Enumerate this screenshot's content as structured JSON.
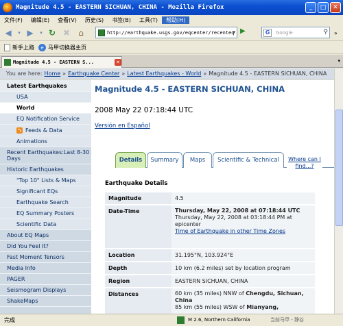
{
  "window": {
    "title": "Magnitude 4.5 - EASTERN SICHUAN, CHINA - Mozilla Firefox",
    "buttons": [
      "_",
      "□",
      "✕"
    ]
  },
  "menubar": {
    "items": [
      "文件(F)",
      "编辑(E)",
      "查看(V)",
      "历史(S)",
      "书签(B)",
      "工具(T)",
      "帮助(H)"
    ]
  },
  "navbar": {
    "url": "http://earthquake.usgs.gov/eqcenter/recenteq",
    "search_placeholder": "Google"
  },
  "bookmarks": {
    "items": [
      "新手上路",
      "马甲切换器主页"
    ]
  },
  "tabbar": {
    "tab_title": "Magnitude 4.5 - EASTERN S..."
  },
  "breadcrumb": {
    "label": "You are here:",
    "items": [
      "Home",
      "Earthquake Center",
      "Latest Earthquakes - World"
    ],
    "current": "Magnitude 4.5 - EASTERN SICHUAN, CHINA"
  },
  "sidebar": {
    "items": [
      {
        "label": "Latest Earthquakes"
      },
      {
        "label": "USA"
      },
      {
        "label": "World"
      },
      {
        "label": "EQ Notification Service"
      },
      {
        "label": "Feeds & Data"
      },
      {
        "label": "Animations"
      },
      {
        "label": "Recent Earthquakes:Last 8-30 Days"
      },
      {
        "label": "Historic Earthquakes"
      },
      {
        "label": "\"Top 10\" Lists & Maps"
      },
      {
        "label": "Significant EQs"
      },
      {
        "label": "Earthquake Search"
      },
      {
        "label": "EQ Summary Posters"
      },
      {
        "label": "Scientific Data"
      },
      {
        "label": "About EQ Maps"
      },
      {
        "label": "Did You Feel It?"
      },
      {
        "label": "Fast Moment Tensors"
      },
      {
        "label": "Media Info"
      },
      {
        "label": "PAGER"
      },
      {
        "label": "Seismogram Displays"
      },
      {
        "label": "ShakeMaps"
      }
    ]
  },
  "main": {
    "title": "Magnitude 4.5 - EASTERN SICHUAN, CHINA",
    "datetime": "2008 May 22 07:18:44 UTC",
    "spanish_link": "Versión en Español",
    "tabs": [
      "Details",
      "Summary",
      "Maps",
      "Scientific & Technical"
    ],
    "where_link": "Where can I find...?",
    "section_title": "Earthquake Details",
    "details": {
      "magnitude_label": "Magnitude",
      "magnitude_value": "4.5",
      "datetime_label": "Date-Time",
      "datetime_utc": "Thursday, May 22, 2008 at 07:18:44 UTC",
      "datetime_local": "Thursday, May 22, 2008 at 03:18:44 PM at epicenter",
      "time_link": "Time of Earthquake in other Time Zones",
      "location_label": "Location",
      "location_value": "31.195°N, 103.924°E",
      "depth_label": "Depth",
      "depth_value": "10 km (6.2 miles) set by location program",
      "region_label": "Region",
      "region_value": "EASTERN SICHUAN, CHINA",
      "distances_label": "Distances",
      "distance_1_prefix": "60 km (35 miles) NNW of ",
      "distance_1_city": "Chengdu, Sichuan, China",
      "distance_2_prefix": "85 km (55 miles) WSW of ",
      "distance_2_city": "Mianyang,"
    }
  },
  "statusbar": {
    "status": "完成",
    "geo": "M 2.6, Northern California",
    "right": "当前马甲 - 静谷"
  },
  "colors": {
    "titlebar": "#0b4fd1",
    "heading": "#1d5190",
    "link": "#00368c",
    "sidebar_bg": "#cfd9e3",
    "active_tab": "#d8f0b8"
  }
}
